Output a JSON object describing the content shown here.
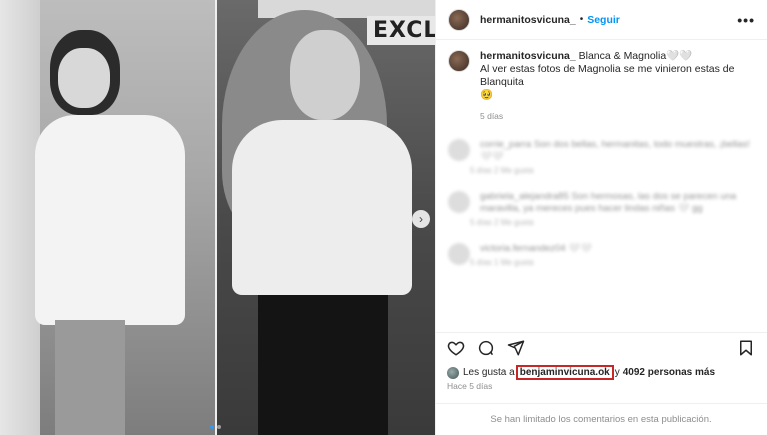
{
  "post": {
    "author": "hermanitosvicuna_",
    "separator": "•",
    "follow_label": "Seguir",
    "more_label": "•••"
  },
  "caption": {
    "author": "hermanitosvicuna_",
    "line1": " Blanca & Magnolia🤍🤍",
    "line2": "Al ver estas fotos de Magnolia se me vinieron estas de Blanquita",
    "line3": "🥹",
    "time": "5 días"
  },
  "comments": [
    {
      "text": "corrie_parra Son dos bellas, hermanitas, todo muestras, ¡bellas! 🤍🤍",
      "meta": "5 días   2 Me gusta"
    },
    {
      "text": "gabriela_alejandra85 Son hermosas, las dos se parecen una maravilla, ya mereces pues hacer lindas niñas 🤍 gg",
      "meta": "5 días   2 Me gusta"
    },
    {
      "text": "victoria.fernandez04 🤍🤍",
      "meta": "5 días   1 Me gusta"
    }
  ],
  "media": {
    "sign_text": "EXCLU",
    "next_label": "›",
    "dots": 2,
    "active_dot": 0
  },
  "likes": {
    "prefix": "Les gusta a",
    "liker": "benjaminvicuna.ok",
    "suffix": "y",
    "count": "4092 personas más"
  },
  "post_time": "Hace 5 días",
  "comments_limited": "Se han limitado los comentarios en esta publicación."
}
